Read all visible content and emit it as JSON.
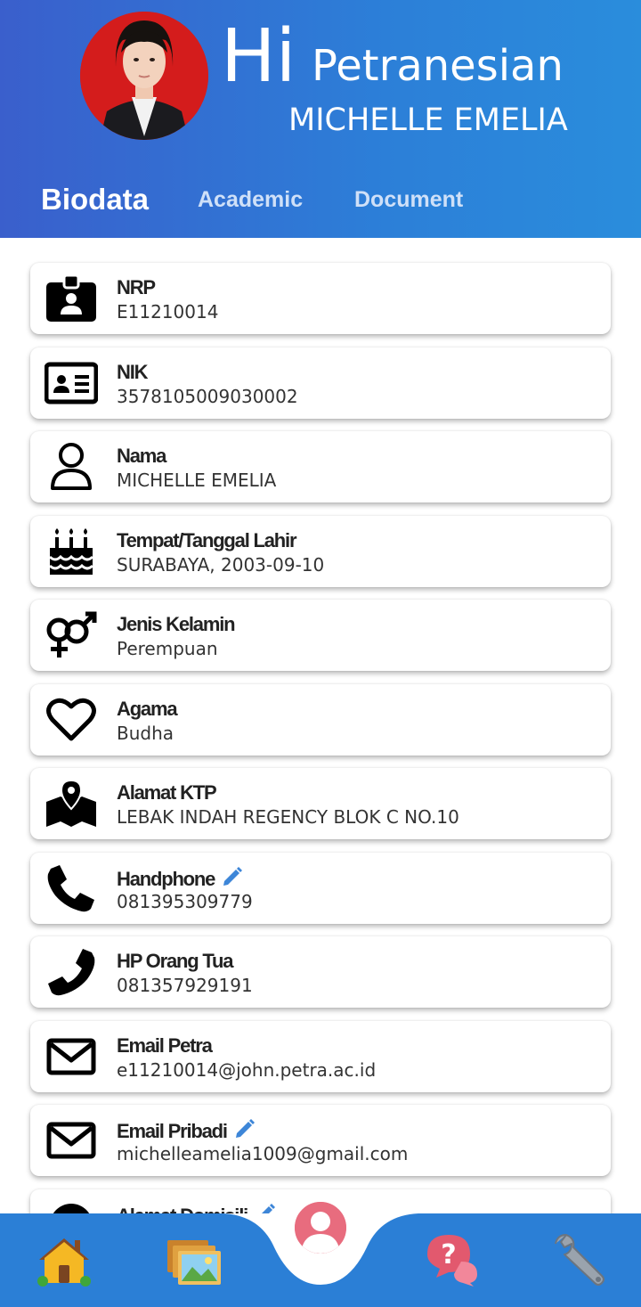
{
  "header": {
    "greeting": "Hi",
    "subtitle": "Petranesian",
    "student_name": "MICHELLE EMELIA"
  },
  "tabs": [
    {
      "label": "Biodata",
      "active": true
    },
    {
      "label": "Academic",
      "active": false
    },
    {
      "label": "Document",
      "active": false
    }
  ],
  "biodata": [
    {
      "icon": "id-badge-icon",
      "label": "NRP",
      "value": "E11210014",
      "editable": false
    },
    {
      "icon": "id-card-icon",
      "label": "NIK",
      "value": "3578105009030002",
      "editable": false
    },
    {
      "icon": "user-icon",
      "label": "Nama",
      "value": "MICHELLE EMELIA",
      "editable": false
    },
    {
      "icon": "birthday-cake-icon",
      "label": "Tempat/Tanggal Lahir",
      "value": "SURABAYA, 2003-09-10",
      "editable": false
    },
    {
      "icon": "gender-icon",
      "label": "Jenis Kelamin",
      "value": "Perempuan",
      "editable": false
    },
    {
      "icon": "heart-icon",
      "label": "Agama",
      "value": "Budha",
      "editable": false
    },
    {
      "icon": "map-location-icon",
      "label": "Alamat KTP",
      "value": "LEBAK INDAH REGENCY BLOK C NO.10",
      "editable": false
    },
    {
      "icon": "phone-icon",
      "label": "Handphone",
      "value": "081395309779",
      "editable": true
    },
    {
      "icon": "phone-icon",
      "label": "HP Orang Tua",
      "value": "081357929191",
      "editable": false
    },
    {
      "icon": "envelope-icon",
      "label": "Email Petra",
      "value": "e11210014@john.petra.ac.id",
      "editable": false
    },
    {
      "icon": "envelope-icon",
      "label": "Email Pribadi",
      "value": "michelleamelia1009@gmail.com",
      "editable": true
    },
    {
      "icon": "home-location-icon",
      "label": "Alamat Domisili",
      "value": "",
      "editable": true
    }
  ],
  "bottom_nav": [
    {
      "name": "home-icon"
    },
    {
      "name": "gallery-icon"
    },
    {
      "name": "profile-icon",
      "active": true
    },
    {
      "name": "help-chat-icon"
    },
    {
      "name": "wrench-icon"
    }
  ],
  "colors": {
    "header_gradient_start": "#3a5fcc",
    "header_gradient_end": "#2a8ddc",
    "nav_background": "#2b7fd6",
    "edit_icon": "#3d86d8",
    "profile_fab": "#e86c7e"
  }
}
